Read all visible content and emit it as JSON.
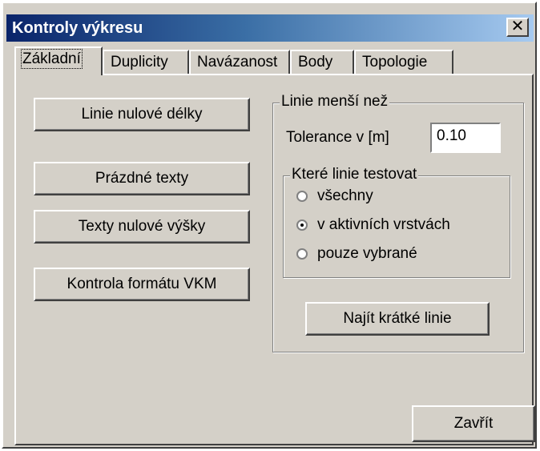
{
  "window": {
    "title": "Kontroly výkresu",
    "close_label": "✕"
  },
  "tabs": [
    {
      "label": "Základní",
      "active": true
    },
    {
      "label": "Duplicity",
      "active": false
    },
    {
      "label": "Navázanost",
      "active": false
    },
    {
      "label": "Body",
      "active": false
    },
    {
      "label": "Topologie",
      "active": false
    }
  ],
  "left_buttons": {
    "zero_length": "Linie nulové délky",
    "empty_texts": "Prázdné texty",
    "zero_height_texts": "Texty nulové výšky",
    "vkm_format": "Kontrola formátu VKM"
  },
  "short_lines_group": {
    "title": "Linie menší než",
    "tolerance_label": "Tolerance  v [m]",
    "tolerance_value": "0.10",
    "which_lines": {
      "title": "Které linie testovat",
      "options": [
        {
          "label": "všechny",
          "checked": false
        },
        {
          "label": "v aktivních vrstvách",
          "checked": true
        },
        {
          "label": "pouze vybrané",
          "checked": false
        }
      ]
    },
    "find_button": "Najít krátké linie"
  },
  "close_button": "Zavřít"
}
